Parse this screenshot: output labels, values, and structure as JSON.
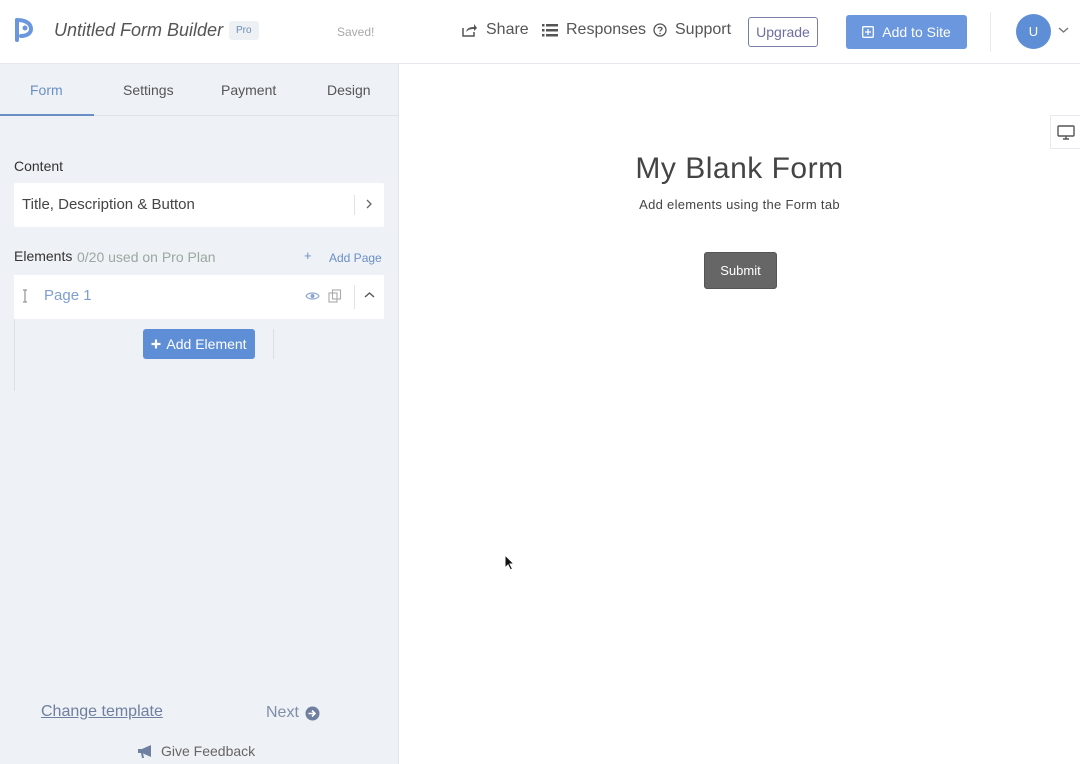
{
  "header": {
    "app_title": "Untitled Form Builder",
    "plan_badge": "Pro",
    "save_status": "Saved!",
    "nav": {
      "share": "Share",
      "responses": "Responses",
      "support": "Support"
    },
    "upgrade_label": "Upgrade",
    "add_to_site_label": "Add to Site",
    "avatar_initial": "U"
  },
  "sidebar": {
    "tabs": [
      "Form",
      "Settings",
      "Payment",
      "Design"
    ],
    "active_tab": "Form",
    "content_label": "Content",
    "content_row": "Title, Description & Button",
    "elements_label": "Elements",
    "elements_usage": "0/20 used on Pro Plan",
    "add_page_plus": "+",
    "add_page_label": "Add Page",
    "page_label": "Page 1",
    "add_element_label": "Add Element",
    "change_template_label": "Change template",
    "next_label": "Next",
    "feedback_label": "Give Feedback"
  },
  "preview": {
    "form_title": "My Blank Form",
    "form_description": "Add elements using the Form tab",
    "submit_label": "Submit"
  },
  "colors": {
    "accent": "#6a97dd",
    "sidebar_bg": "#eef1f5",
    "submit_bg": "#666666"
  }
}
